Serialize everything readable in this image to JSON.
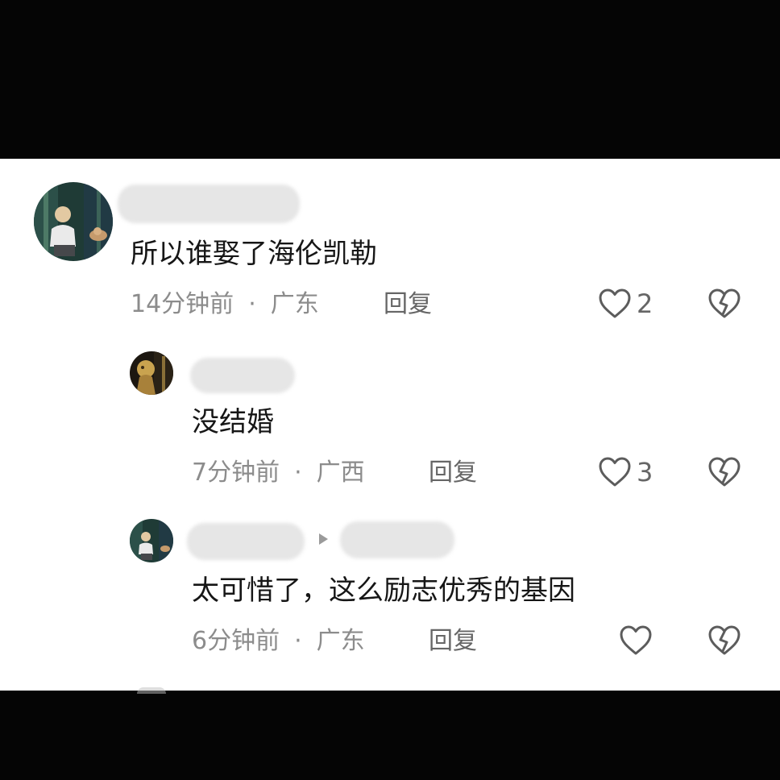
{
  "comments": [
    {
      "text": "所以谁娶了海伦凯勒",
      "time": "14分钟前",
      "separator": "·",
      "location": "广东",
      "reply_label": "回复",
      "likes": "2"
    },
    {
      "text": "没结婚",
      "time": "7分钟前",
      "separator": "·",
      "location": "广西",
      "reply_label": "回复",
      "likes": "3"
    },
    {
      "text": "太可惜了，这么励志优秀的基因",
      "time": "6分钟前",
      "separator": "·",
      "location": "广东",
      "reply_label": "回复",
      "likes": ""
    }
  ],
  "icons": {
    "like": "heart-outline-icon",
    "dislike": "broken-heart-icon",
    "reply_to": "triangle-right-icon"
  },
  "colors": {
    "background": "#050505",
    "panel": "#ffffff",
    "text": "#161616",
    "meta": "#8c8c8c"
  }
}
